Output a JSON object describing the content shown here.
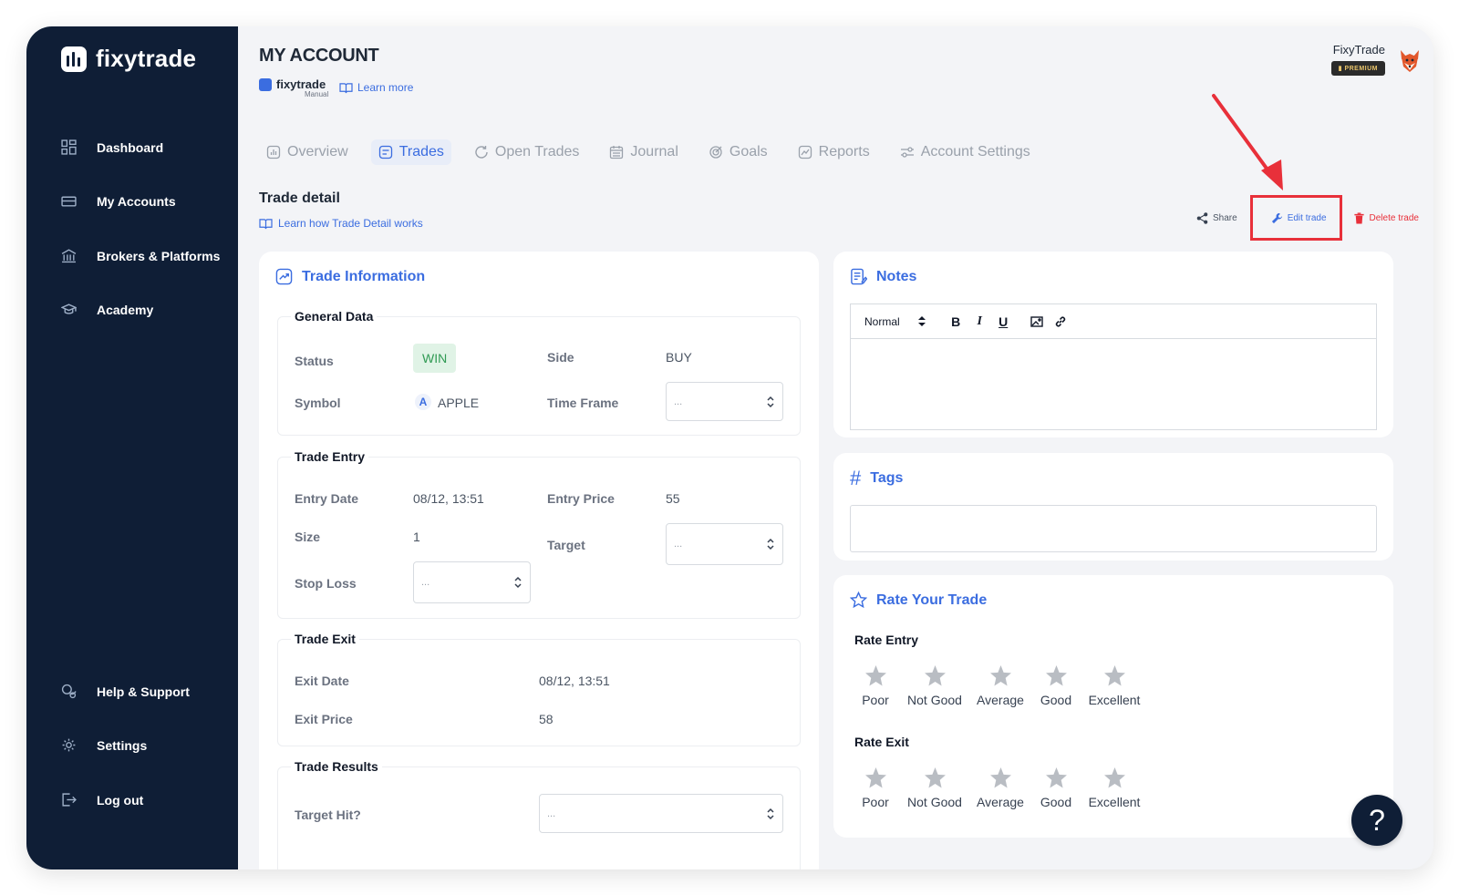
{
  "brand": {
    "name": "fixytrade"
  },
  "sidebar": {
    "items": [
      {
        "label": "Dashboard",
        "icon": "grid-icon"
      },
      {
        "label": "My Accounts",
        "icon": "card-icon"
      },
      {
        "label": "Brokers & Platforms",
        "icon": "bank-icon"
      },
      {
        "label": "Academy",
        "icon": "graduation-cap-icon"
      }
    ],
    "bottom_items": [
      {
        "label": "Help & Support",
        "icon": "chat-icon"
      },
      {
        "label": "Settings",
        "icon": "gear-icon"
      },
      {
        "label": "Log out",
        "icon": "logout-icon"
      }
    ]
  },
  "header": {
    "title": "MY ACCOUNT",
    "account_name": "fixytrade",
    "account_type": "Manual",
    "learn_more": "Learn more",
    "user_name": "FixyTrade",
    "badge": "PREMIUM"
  },
  "tabs": [
    {
      "label": "Overview",
      "icon": "overview-icon"
    },
    {
      "label": "Trades",
      "icon": "trades-icon",
      "active": true
    },
    {
      "label": "Open Trades",
      "icon": "refresh-icon"
    },
    {
      "label": "Journal",
      "icon": "calendar-icon"
    },
    {
      "label": "Goals",
      "icon": "target-icon"
    },
    {
      "label": "Reports",
      "icon": "reports-icon"
    },
    {
      "label": "Account Settings",
      "icon": "sliders-icon"
    }
  ],
  "trade_detail": {
    "title": "Trade detail",
    "learn": "Learn how Trade Detail works",
    "actions": {
      "share": "Share",
      "edit": "Edit trade",
      "delete": "Delete trade"
    }
  },
  "trade_info": {
    "title": "Trade Information",
    "general": {
      "title": "General Data",
      "status_label": "Status",
      "status_value": "WIN",
      "side_label": "Side",
      "side_value": "BUY",
      "symbol_label": "Symbol",
      "symbol_icon_letter": "A",
      "symbol_value": "APPLE",
      "timeframe_label": "Time Frame",
      "timeframe_value": "..."
    },
    "entry": {
      "title": "Trade Entry",
      "entry_date_label": "Entry Date",
      "entry_date_value": "08/12, 13:51",
      "entry_price_label": "Entry Price",
      "entry_price_value": "55",
      "size_label": "Size",
      "size_value": "1",
      "target_label": "Target",
      "target_value": "...",
      "stoploss_label": "Stop Loss",
      "stoploss_value": "..."
    },
    "exit": {
      "title": "Trade Exit",
      "exit_date_label": "Exit Date",
      "exit_date_value": "08/12, 13:51",
      "exit_price_label": "Exit Price",
      "exit_price_value": "58"
    },
    "results": {
      "title": "Trade Results",
      "target_hit_label": "Target Hit?",
      "target_hit_value": "..."
    }
  },
  "notes": {
    "title": "Notes",
    "format": "Normal",
    "bold": "B",
    "italic": "I",
    "underline": "U"
  },
  "tags": {
    "title": "Tags"
  },
  "rating": {
    "title": "Rate Your Trade",
    "entry_label": "Rate Entry",
    "exit_label": "Rate Exit",
    "options": [
      "Poor",
      "Not Good",
      "Average",
      "Good",
      "Excellent"
    ],
    "entry_value": 0,
    "exit_value": 0
  },
  "help": {
    "label": "?"
  },
  "colors": {
    "sidebar": "#0f1e36",
    "accent": "#3b6de0",
    "danger": "#e8303a",
    "win": "#2f9a53"
  }
}
